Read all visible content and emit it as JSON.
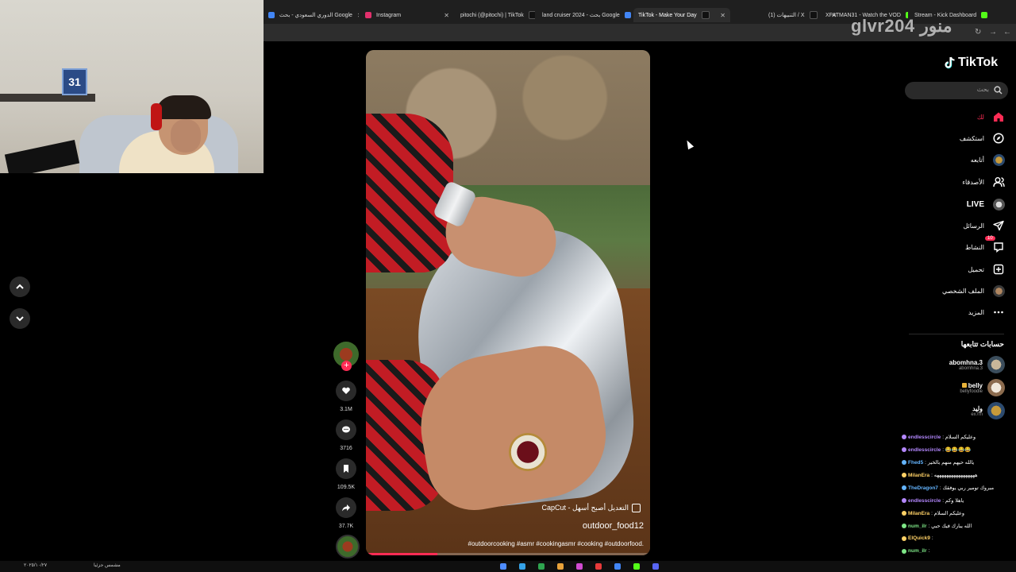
{
  "browser": {
    "tabs": [
      {
        "title": "الدوري السعودي - بحث Google",
        "fav": "#4285f4"
      },
      {
        "title": "Instagram",
        "fav": "#e1306c"
      },
      {
        "title": "pitochi (@pitochi) | TikTok",
        "fav": "#111111"
      },
      {
        "title": "land cruiser 2024 - بحث Google",
        "fav": "#4285f4"
      },
      {
        "title": "TikTok - Make Your Day",
        "fav": "#111111",
        "active": true
      },
      {
        "title": "(1) التنبيهات / X",
        "fav": "#111111"
      },
      {
        "title": "XFATMAN31 - Watch the VOD",
        "fav": "#53fc18"
      },
      {
        "title": "Stream - Kick Dashboard",
        "fav": "#53fc18"
      }
    ],
    "close_glyph": "✕"
  },
  "overlay": {
    "brand": "glvr204 منور"
  },
  "webcam": {
    "frame_number": "31"
  },
  "video": {
    "capcut_text": "CapCut - التعديل أصبح أسهل",
    "author": "outdoor_food12",
    "hashtags": "#outdoorcooking #asmr #cookingasmr #cooking #outdoorfood.",
    "progress": 0.25
  },
  "actions": {
    "likes": "3.1M",
    "comments": "3716",
    "saves": "109.5K",
    "shares": "37.7K"
  },
  "sidebar": {
    "logo": "TikTok",
    "search_placeholder": "بحث",
    "nav": [
      {
        "label": "لك",
        "icon": "home-icon",
        "active": true
      },
      {
        "label": "استكشف",
        "icon": "compass-icon"
      },
      {
        "label": "أتابعه",
        "icon": "following-avatar-icon"
      },
      {
        "label": "الأصدقاء",
        "icon": "friends-icon"
      },
      {
        "label": "LIVE",
        "icon": "live-avatar-icon"
      },
      {
        "label": "الرسائل",
        "icon": "send-icon"
      },
      {
        "label": "النشاط",
        "icon": "activity-icon",
        "badge": "10"
      },
      {
        "label": "تحميل",
        "icon": "upload-icon"
      },
      {
        "label": "الملف الشخصي",
        "icon": "profile-avatar-icon"
      },
      {
        "label": "المزيد",
        "icon": "more-icon"
      }
    ],
    "following_title": "حسابات تتابعها",
    "following": [
      {
        "name": "abomhna.3",
        "handle": "abomhna.3"
      },
      {
        "name": "belly",
        "handle": "bellyfoodie"
      },
      {
        "name": "وليد",
        "handle": "ex7m"
      }
    ]
  },
  "chat": [
    {
      "user": "endlesscircle",
      "text": ": وعليكم السلام",
      "color": "#b488ff"
    },
    {
      "user": "endlesscircle",
      "text": ": 😂😂😂😂",
      "color": "#b488ff"
    },
    {
      "user": "Fhed5",
      "text": ": يالله حيهم منهم بالخير",
      "color": "#64b5ff"
    },
    {
      "user": "MilanEra",
      "text": ": هههههههههههههههههه",
      "color": "#ffd166"
    },
    {
      "user": "TheDragon7",
      "text": ": مبروك تومير ربي يوفقك",
      "color": "#64b5ff"
    },
    {
      "user": "endlesscircle",
      "text": ": ياهلا وكم",
      "color": "#b488ff"
    },
    {
      "user": "MilanEra",
      "text": ": وعليكم السلام",
      "color": "#ffd166"
    },
    {
      "user": "num_ilr",
      "text": ": الله يبارك فيك حبي",
      "color": "#7ee787"
    },
    {
      "user": "ElQuick9",
      "text": ":",
      "color": "#ffd166"
    },
    {
      "user": "num_ilr",
      "text": ":",
      "color": "#7ee787"
    }
  ],
  "taskbar": {
    "left_text": "مشمس جزئيا",
    "date": "٢٠٢٥/١٠/٢٧"
  }
}
